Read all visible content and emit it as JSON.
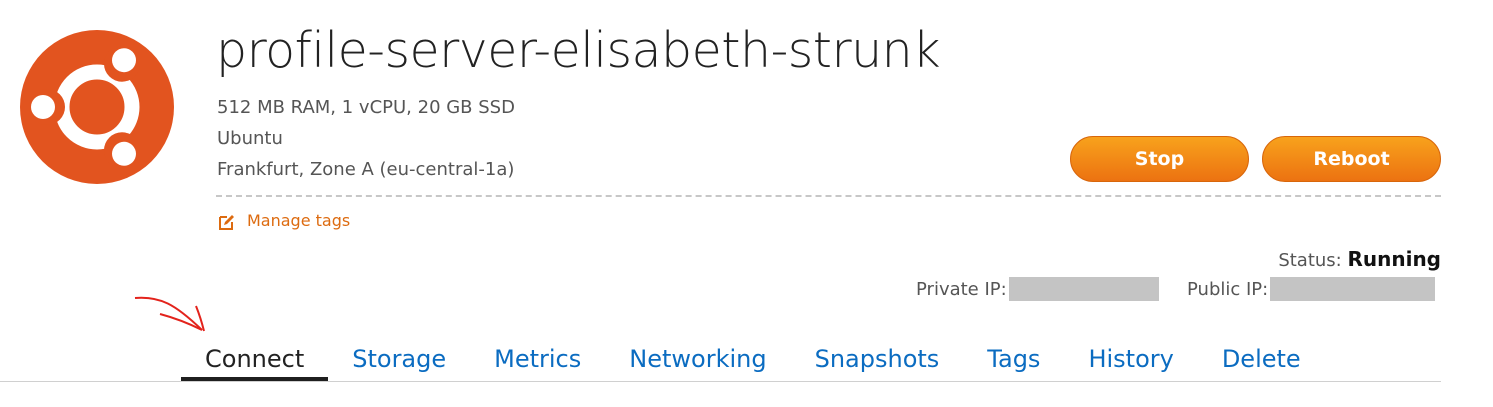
{
  "instance": {
    "name": "profile-server-elisabeth-strunk",
    "specs": "512 MB RAM, 1 vCPU, 20 GB SSD",
    "os": "Ubuntu",
    "location": "Frankfurt, Zone A (eu-central-1a)",
    "logo_icon": "ubuntu-logo-icon",
    "logo_color": "#e2541f"
  },
  "actions": {
    "stop_label": "Stop",
    "reboot_label": "Reboot",
    "button_color": "#f28e16"
  },
  "tags": {
    "manage_label": "Manage tags",
    "icon": "edit-icon"
  },
  "status": {
    "label": "Status:",
    "value": "Running"
  },
  "ips": {
    "private_label": "Private IP:",
    "public_label": "Public IP:"
  },
  "tabs": [
    {
      "label": "Connect",
      "active": true
    },
    {
      "label": "Storage"
    },
    {
      "label": "Metrics"
    },
    {
      "label": "Networking"
    },
    {
      "label": "Snapshots"
    },
    {
      "label": "Tags"
    },
    {
      "label": "History"
    },
    {
      "label": "Delete"
    }
  ],
  "accent": {
    "link": "#0b6cc1",
    "annotation_arrow": "#e3231c"
  }
}
